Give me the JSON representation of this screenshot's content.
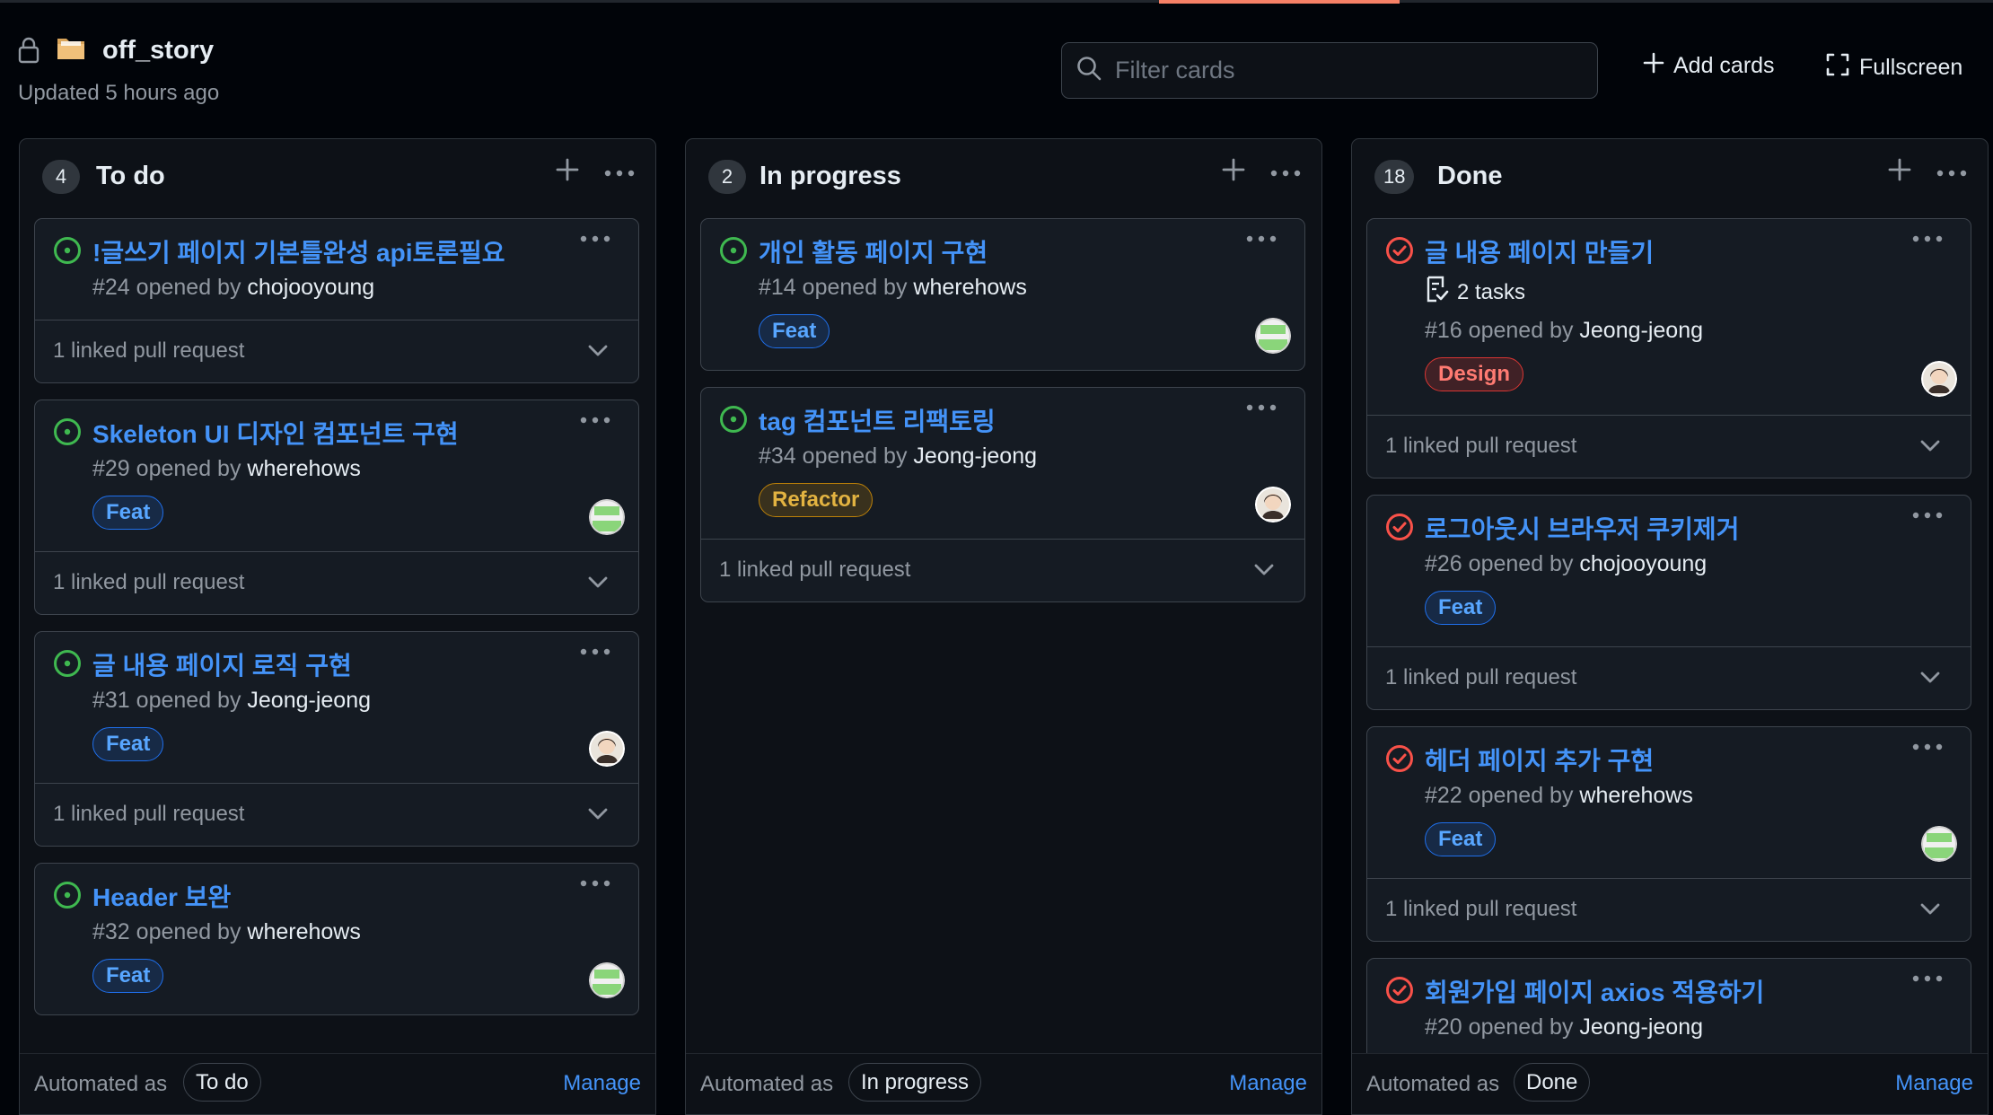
{
  "header": {
    "project_name": "off_story",
    "updated": "Updated 5 hours ago",
    "filter_placeholder": "Filter cards",
    "add_cards": "Add cards",
    "fullscreen": "Fullscreen"
  },
  "columns": [
    {
      "count": "4",
      "name": "To do",
      "automated_label": "Automated as",
      "automated_value": "To do",
      "manage": "Manage",
      "cards": [
        {
          "title": "!글쓰기 페이지 기본틀완성 api토론필요",
          "number": "#24",
          "opened_by": "opened by",
          "user": "chojooyoung",
          "linked": "1 linked pull request",
          "status": "open"
        },
        {
          "title": "Skeleton UI 디자인 컴포넌트 구현",
          "number": "#29",
          "opened_by": "opened by",
          "user": "wherehows",
          "label": "Feat",
          "linked": "1 linked pull request",
          "status": "open",
          "avatar": "green"
        },
        {
          "title": "글 내용 페이지 로직 구현",
          "number": "#31",
          "opened_by": "opened by",
          "user": "Jeong-jeong",
          "label": "Feat",
          "linked": "1 linked pull request",
          "status": "open",
          "avatar": "person"
        },
        {
          "title": "Header 보완",
          "number": "#32",
          "opened_by": "opened by",
          "user": "wherehows",
          "label": "Feat",
          "status": "open",
          "avatar": "green"
        }
      ]
    },
    {
      "count": "2",
      "name": "In progress",
      "automated_label": "Automated as",
      "automated_value": "In progress",
      "manage": "Manage",
      "cards": [
        {
          "title": "개인 활동 페이지 구현",
          "number": "#14",
          "opened_by": "opened by",
          "user": "wherehows",
          "label": "Feat",
          "status": "open",
          "avatar": "green"
        },
        {
          "title": "tag 컴포넌트 리팩토링",
          "number": "#34",
          "opened_by": "opened by",
          "user": "Jeong-jeong",
          "label": "Refactor",
          "linked": "1 linked pull request",
          "status": "open",
          "avatar": "person"
        }
      ]
    },
    {
      "count": "18",
      "name": "Done",
      "automated_label": "Automated as",
      "automated_value": "Done",
      "manage": "Manage",
      "cards": [
        {
          "title": "글 내용 페이지 만들기",
          "tasks": "2 tasks",
          "number": "#16",
          "opened_by": "opened by",
          "user": "Jeong-jeong",
          "label": "Design",
          "linked": "1 linked pull request",
          "status": "closed",
          "avatar": "person"
        },
        {
          "title": "로그아웃시 브라우저 쿠키제거",
          "number": "#26",
          "opened_by": "opened by",
          "user": "chojooyoung",
          "label": "Feat",
          "linked": "1 linked pull request",
          "status": "closed"
        },
        {
          "title": "헤더 페이지 추가 구현",
          "number": "#22",
          "opened_by": "opened by",
          "user": "wherehows",
          "label": "Feat",
          "linked": "1 linked pull request",
          "status": "closed",
          "avatar": "green"
        },
        {
          "title": "회원가입 페이지 axios 적용하기",
          "number": "#20",
          "opened_by": "opened by",
          "user": "Jeong-jeong",
          "status": "closed"
        }
      ]
    }
  ],
  "colors": {
    "background": "#010409",
    "column": "#0d1117",
    "card": "#151b23",
    "link": "#4493f8",
    "open": "#3fb950",
    "closed": "#f85149",
    "accent": "#f78166"
  }
}
